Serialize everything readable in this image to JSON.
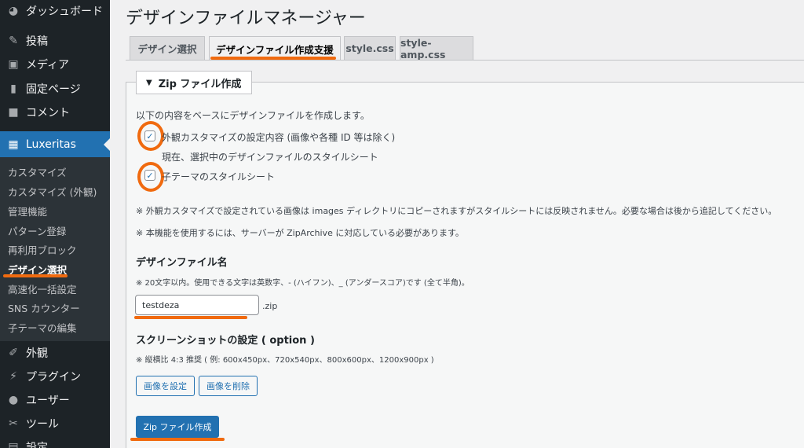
{
  "sidebar": {
    "top_items": [
      {
        "label": "ダッシュボード",
        "icon": "dashboard-icon"
      },
      {
        "label": "投稿",
        "icon": "pin-icon"
      },
      {
        "label": "メディア",
        "icon": "media-icon"
      },
      {
        "label": "固定ページ",
        "icon": "page-icon"
      },
      {
        "label": "コメント",
        "icon": "comment-icon"
      },
      {
        "label": "Luxeritas",
        "icon": "luxeritas-icon"
      }
    ],
    "submenu": [
      "カスタマイズ",
      "カスタマイズ (外観)",
      "管理機能",
      "パターン登録",
      "再利用ブロック",
      "デザイン選択",
      "高速化一括設定",
      "SNS カウンター",
      "子テーマの編集"
    ],
    "bottom_items": [
      {
        "label": "外観",
        "icon": "brush-icon"
      },
      {
        "label": "プラグイン",
        "icon": "plugin-icon"
      },
      {
        "label": "ユーザー",
        "icon": "user-icon"
      },
      {
        "label": "ツール",
        "icon": "wrench-icon"
      },
      {
        "label": "設定",
        "icon": "settings-icon"
      }
    ]
  },
  "page": {
    "title": "デザインファイルマネージャー",
    "tabs": [
      "デザイン選択",
      "デザインファイル作成支援",
      "style.css",
      "style-amp.css"
    ]
  },
  "panel": {
    "legend": "Zip ファイル作成",
    "intro": "以下の内容をベースにデザインファイルを作成します。",
    "checkbox1_label": "外観カスタマイズの設定内容 (画像や各種 ID 等は除く)",
    "checkbox1_sub": "現在、選択中のデザインファイルのスタイルシート",
    "checkbox2_label": "子テーマのスタイルシート",
    "note1": "※ 外観カスタマイズで設定されている画像は images ディレクトリにコピーされますがスタイルシートには反映されません。必要な場合は後から追記してください。",
    "note2": "※ 本機能を使用するには、サーバーが ZipArchive に対応している必要があります。",
    "name_heading": "デザインファイル名",
    "name_note": "※ 20文字以内。使用できる文字は英数字、- (ハイフン)、_ (アンダースコア)です (全て半角)。",
    "name_value": "testdeza",
    "name_suffix": ".zip",
    "screenshot_heading": "スクリーンショットの設定 ( option )",
    "screenshot_note": "※ 縦横比 4:3 推奨 ( 例: 600x450px、720x540px、800x600px、1200x900px )",
    "set_image_btn": "画像を設定",
    "delete_image_btn": "画像を削除",
    "zip_btn": "Zip ファイル作成"
  },
  "colors": {
    "sidebar_bg": "#1d2327",
    "accent_blue": "#2271b1",
    "annotation_orange": "#f06a0f"
  }
}
